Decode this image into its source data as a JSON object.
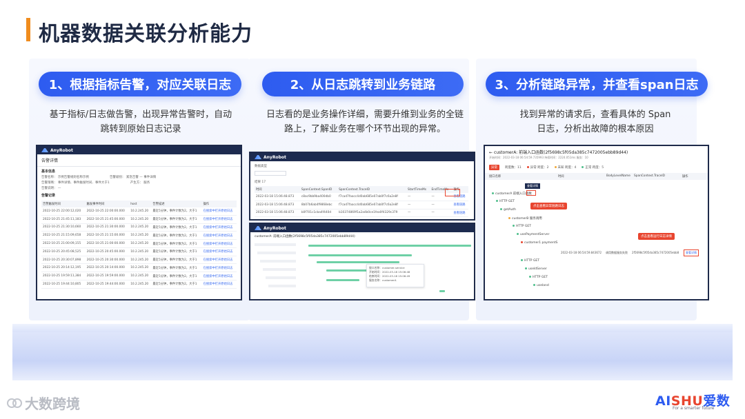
{
  "page": {
    "title": "机器数据关联分析能力"
  },
  "steps": [
    {
      "label": "1、根据指标告警，对应关联日志",
      "desc_line1": "基于指标/日志做告警，出现异常告警时，自动",
      "desc_line2": "跳转到原始日志记录"
    },
    {
      "label": "2、从日志跳转到业务链路",
      "desc_line1": "日志看的是业务操作详细，需要升维到业务的全链",
      "desc_line2": "路上，了解业务在哪个环节出现的异常。"
    },
    {
      "label": "3、分析链路异常，并查看span日志",
      "desc_line1": "找到异常的请求后，查看具体的 Span",
      "desc_line2": "日志，分析出故障的根本原因"
    }
  ],
  "shot1": {
    "app_name": "AnyRobot",
    "header": "告警详情",
    "basic_info": "基本信息",
    "alarm_records": "告警记录",
    "kv1_a": "告警名称：  示例告警规则名称示例",
    "kv1_b": "告警级别：  紧急告警 — 事件详情",
    "kv2_a": "告警策略：  事件详情、事件触发时间、事件大于1",
    "kv2_b": "产生方：  服务",
    "kv3": "告警说明：  —",
    "columns": [
      "告警触发时间",
      "触发事件时间",
      "host",
      "告警描述",
      "操作"
    ],
    "rows": [
      [
        "2022-10-25 22:00:12,020",
        "2022-10-25 22:00:00.000",
        "10.2.245.20",
        "最近5分钟，事件计数为2，大于1",
        "在搜索中打开原始日志"
      ],
      [
        "2022-10-25 21:45:11,183",
        "2022-10-25 21:45:00.000",
        "10.2.245.20",
        "最近5分钟，事件计数为2，大于1",
        "在搜索中打开原始日志"
      ],
      [
        "2022-10-25 21:30:10,660",
        "2022-10-25 21:30:00.000",
        "10.2.245.20",
        "最近5分钟，事件计数为2，大于1",
        "在搜索中打开原始日志"
      ],
      [
        "2022-10-25 21:15:09,658",
        "2022-10-25 21:15:00.000",
        "10.2.245.20",
        "最近5分钟，事件计数为2，大于1",
        "在搜索中打开原始日志"
      ],
      [
        "2022-10-25 21:00:09,155",
        "2022-10-25 21:00:00.000",
        "10.2.245.20",
        "最近5分钟，事件计数为2，大于1",
        "在搜索中打开原始日志"
      ],
      [
        "2022-10-25 20:45:08,525",
        "2022-10-25 20:45:00.000",
        "10.2.245.20",
        "最近5分钟，事件计数为2，大于1",
        "在搜索中打开原始日志"
      ],
      [
        "2022-10-25 20:30:07,898",
        "2022-10-25 20:30:00.000",
        "10.2.245.20",
        "最近5分钟，事件计数为2，大于1",
        "在搜索中打开原始日志"
      ],
      [
        "2022-10-25 20:14:12,195",
        "2022-10-25 20:14:00.000",
        "10.2.245.20",
        "最近5分钟，事件计数为2，大于1",
        "在搜索中打开原始日志"
      ],
      [
        "2022-10-25 19:59:11,384",
        "2022-10-25 19:59:00.000",
        "10.2.245.20",
        "最近5分钟，事件计数为2，大于1",
        "在搜索中打开原始日志"
      ],
      [
        "2022-10-25 19:44:10,805",
        "2022-10-25 19:44:00.000",
        "10.2.245.20",
        "最近5分钟，事件计数为2，大于1",
        "在搜索中打开原始日志"
      ]
    ]
  },
  "shot2": {
    "app_name": "AnyRobot",
    "filter_label": "数据类型",
    "count_label": "结果 17",
    "columns": [
      "时间",
      "SpanContext.SpanID",
      "SpanContext.TraceID",
      "StartTimeMs",
      "EndTimeMs",
      "操作"
    ],
    "rows": [
      [
        "2022-03-18 15:06:48.873",
        "c8ac9bb9ba400db0",
        "f7cad7faacc4d0ab685e07ab0f7c6a2e8f",
        "—",
        "—",
        "查看链路"
      ],
      [
        "2022-03-18 15:06:48.873",
        "8b07b6ab4f9868ebc",
        "f7cad7faacc4d0ab685e07ab0f7c6a2e8f",
        "—",
        "—",
        "查看链路"
      ],
      [
        "2022-03-18 15:06:48.873",
        "b0f701c1cba4f440d",
        "b10374869f1a2a4b0ce1fea0f4329c379",
        "—",
        "—",
        "查看链路"
      ]
    ],
    "trace_title": "customerA: 前端入口函数(2f5698c5f05da385c7472005ebb89d44)",
    "tooltip1": "接口名称：customer-service",
    "tooltip2": "开始时间：2022-03-18 15:06:48",
    "tooltip3": "结束时间：2022-03-18 15:06:49",
    "tooltip4": "服务名称：customerA"
  },
  "shot3": {
    "title": "customerA: 前端入口函数(2f5698c5f05da385c7472005ebb89d44)",
    "meta": "开始时间：2022-03-18 06:54:59.735993      持续时间：2224.051ms      服务：10",
    "filter_chip": "异常",
    "stat1": "跨度数：11",
    "stat2": "异常 跨度：2",
    "stat3": "未知 跨度：4",
    "stat4": "正常 跨度：5",
    "columns": [
      "接口名称",
      "时间",
      "BodyLevelName",
      "SpanContext.TraceID",
      "操作"
    ],
    "tree": [
      "customerA 前端入口函数",
      "HTTP GET",
      "getAuth",
      "customerB 服务调用",
      "HTTP GET",
      "usePaymentServer",
      "customer1 paymentS",
      "HTTP GET",
      "useIdServer",
      "HTTP GET",
      "useIand"
    ],
    "badge_view": "查看详情",
    "tag1": "点击查看异常链路日志",
    "tag2": "点击查看运行日志详情",
    "log_time": "2022-03-18 06:54:59.843672",
    "log_level": "调用数据服务失败",
    "log_trace": "2f5698c5f05da385c7472005ebb8",
    "log_action": "查看详情"
  },
  "footer": {
    "left_brand": "大数跨境",
    "brand_a": "AI",
    "brand_b": "SHU",
    "brand_c": "爱数",
    "brand_tagline": "For a smarter future"
  }
}
